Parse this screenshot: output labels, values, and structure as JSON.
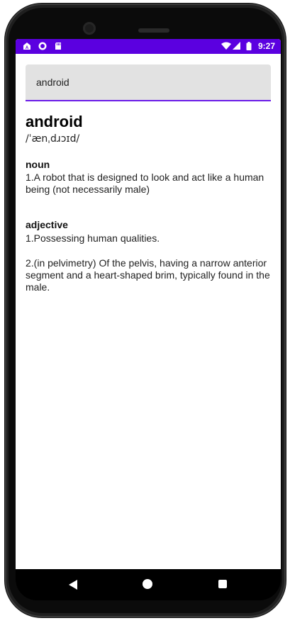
{
  "status_bar": {
    "time": "9:27",
    "icons": [
      "launcher-icon",
      "sync-icon",
      "sd-card-icon",
      "wifi-icon",
      "signal-icon",
      "battery-icon"
    ],
    "color": "#5b00e0"
  },
  "search": {
    "value": "android"
  },
  "entry": {
    "word": "android",
    "phonetic": "/ˈænˌdɹɔɪd/",
    "meanings": [
      {
        "part_of_speech": "noun",
        "definitions": [
          "1.A robot that is designed to look and act like a human being (not necessarily male)"
        ]
      },
      {
        "part_of_speech": "adjective",
        "definitions": [
          "1.Possessing human qualities.",
          "2.(in pelvimetry) Of the pelvis, having a narrow anterior segment and a heart-shaped brim, typically found in the male."
        ]
      }
    ]
  },
  "nav_bar": {
    "buttons": [
      "back",
      "home",
      "recents"
    ]
  },
  "colors": {
    "accent": "#6a1be8",
    "search_bg": "#e2e2e2"
  }
}
